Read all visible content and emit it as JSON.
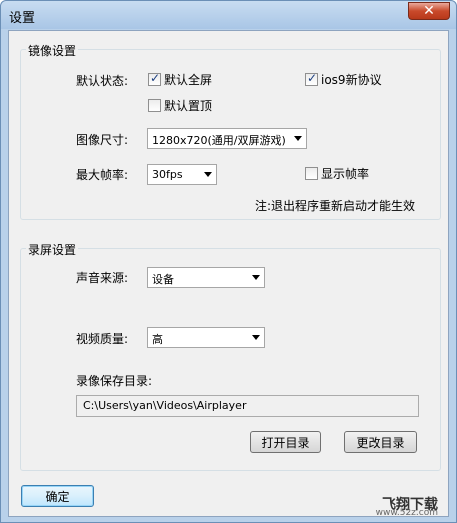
{
  "window": {
    "title": "设置",
    "close_label": "✕"
  },
  "mirror": {
    "title": "镜像设置",
    "default_state_label": "默认状态:",
    "fullscreen_label": "默认全屏",
    "fullscreen_checked": true,
    "ios9_label": "ios9新协议",
    "ios9_checked": true,
    "pin_top_label": "默认置顶",
    "pin_top_checked": false,
    "image_size_label": "图像尺寸:",
    "image_size_value": "1280x720(通用/双屏游戏)",
    "max_fps_label": "最大帧率:",
    "max_fps_value": "30fps",
    "show_fps_label": "显示帧率",
    "show_fps_checked": false,
    "note": "注:退出程序重新启动才能生效"
  },
  "record": {
    "title": "录屏设置",
    "audio_source_label": "声音来源:",
    "audio_source_value": "设备",
    "video_quality_label": "视频质量:",
    "video_quality_value": "高",
    "save_dir_label": "录像保存目录:",
    "save_dir_value": "C:\\Users\\yan\\Videos\\Airplayer",
    "open_dir_button": "打开目录",
    "change_dir_button": "更改目录"
  },
  "footer": {
    "ok_button": "确定"
  },
  "watermark": {
    "text": "飞翔下载",
    "sub": "www.52z.com"
  }
}
